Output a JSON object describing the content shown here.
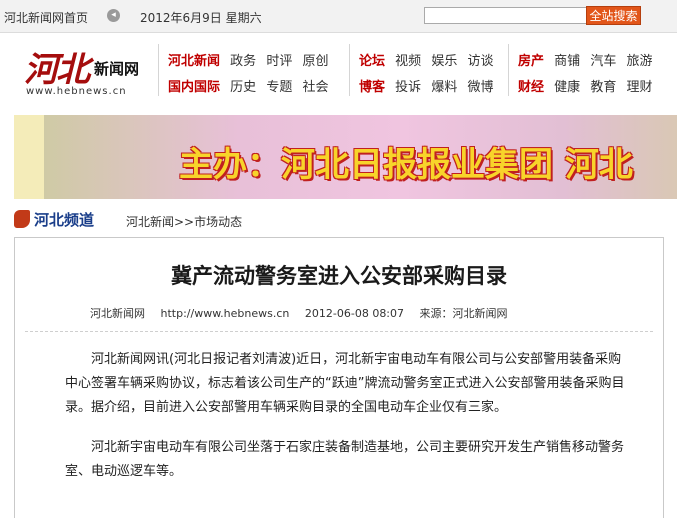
{
  "topbar": {
    "home_link": "河北新闻网首页",
    "sep_glyph": "◂",
    "date": "2012年6月9日 星期六",
    "search_value": "",
    "search_button": "全站搜索"
  },
  "logo": {
    "big": "河北",
    "small": "新闻网",
    "url": "www.hebnews.cn"
  },
  "nav": {
    "group1": {
      "row1": [
        "河北新闻",
        "政务",
        "时评",
        "原创"
      ],
      "row2": [
        "国内国际",
        "历史",
        "专题",
        "社会"
      ]
    },
    "group2": {
      "row1": [
        "论坛",
        "视频",
        "娱乐",
        "访谈"
      ],
      "row2": [
        "博客",
        "投诉",
        "爆料",
        "微博"
      ]
    },
    "group3": {
      "row1": [
        "房产",
        "商铺",
        "汽车",
        "旅游"
      ],
      "row2": [
        "财经",
        "健康",
        "教育",
        "理财"
      ]
    }
  },
  "banner": {
    "text": "主办：河北日报报业集团 河北"
  },
  "channel": {
    "title": "河北频道",
    "breadcrumb": "河北新闻>>市场动态"
  },
  "article": {
    "title": "冀产流动警务室进入公安部采购目录",
    "meta": {
      "site": "河北新闻网",
      "url": "http://www.hebnews.cn",
      "datetime": "2012-06-08 08:07",
      "source": "来源：河北新闻网"
    },
    "paragraphs": [
      "河北新闻网讯(河北日报记者刘清波)近日，河北新宇宙电动车有限公司与公安部警用装备采购中心签署车辆采购协议，标志着该公司生产的“跃迪”牌流动警务室正式进入公安部警用装备采购目录。据介绍，目前进入公安部警用车辆采购目录的全国电动车企业仅有三家。",
      "河北新宇宙电动车有限公司坐落于石家庄装备制造基地，公司主要研究开发生产销售移动警务室、电动巡逻车等。"
    ]
  },
  "colors": {
    "accent_red": "#c00000",
    "search_button": "#e2561a",
    "channel_blue": "#1a3e8a",
    "banner_text": "#f8d42a"
  }
}
